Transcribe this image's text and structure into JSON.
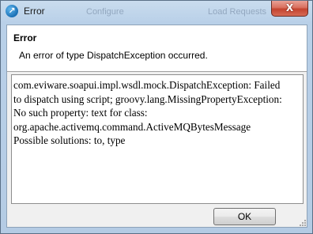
{
  "window": {
    "title": "Error",
    "icon": "soapui-logo-icon",
    "close_label": "X",
    "background_text": [
      "Configure",
      "Load Requests"
    ]
  },
  "header": {
    "title": "Error",
    "message": "An error of type DispatchException occurred."
  },
  "details": {
    "lines": [
      "com.eviware.soapui.impl.wsdl.mock.DispatchException: Failed",
      "to dispatch using script; groovy.lang.MissingPropertyException:",
      "No such property: text for class:",
      "org.apache.activemq.command.ActiveMQBytesMessage",
      "Possible solutions: to, type"
    ]
  },
  "buttons": {
    "ok_label": "OK"
  },
  "colors": {
    "titlebar": "#b9d0e8",
    "close_button": "#c4432f",
    "client_background": "#f0f0f0",
    "header_background": "#ffffff"
  }
}
